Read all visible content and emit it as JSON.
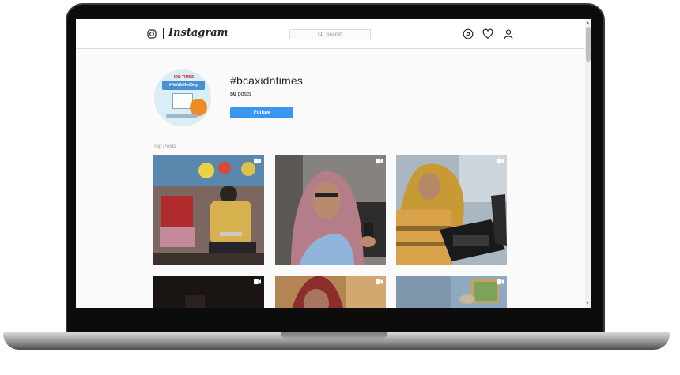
{
  "nav": {
    "logo_text": "Instagram",
    "search_placeholder": "Search",
    "icons": [
      "instagram-glyph-icon",
      "compass-icon",
      "heart-icon",
      "profile-icon"
    ]
  },
  "hashtag": {
    "title": "#bcaxidntimes",
    "post_count": "50",
    "post_label": "posts",
    "follow_label": "Follow"
  },
  "avatar_art": {
    "brand": "IDN TIMES",
    "tag": "#NoWalletDay"
  },
  "section": {
    "top_posts_label": "Top Posts"
  },
  "posts": [
    {
      "kind": "video",
      "scene": "man-with-tablet-in-room"
    },
    {
      "kind": "video",
      "scene": "woman-in-hijab-with-phone"
    },
    {
      "kind": "video",
      "scene": "woman-at-laptop"
    },
    {
      "kind": "video",
      "scene": "dark-room"
    },
    {
      "kind": "video",
      "scene": "woman-in-red-hijab"
    },
    {
      "kind": "video",
      "scene": "room-with-curtain"
    }
  ],
  "colors": {
    "accent": "#3897f0",
    "text": "#262626",
    "muted": "#999999",
    "background": "#fafafa"
  }
}
